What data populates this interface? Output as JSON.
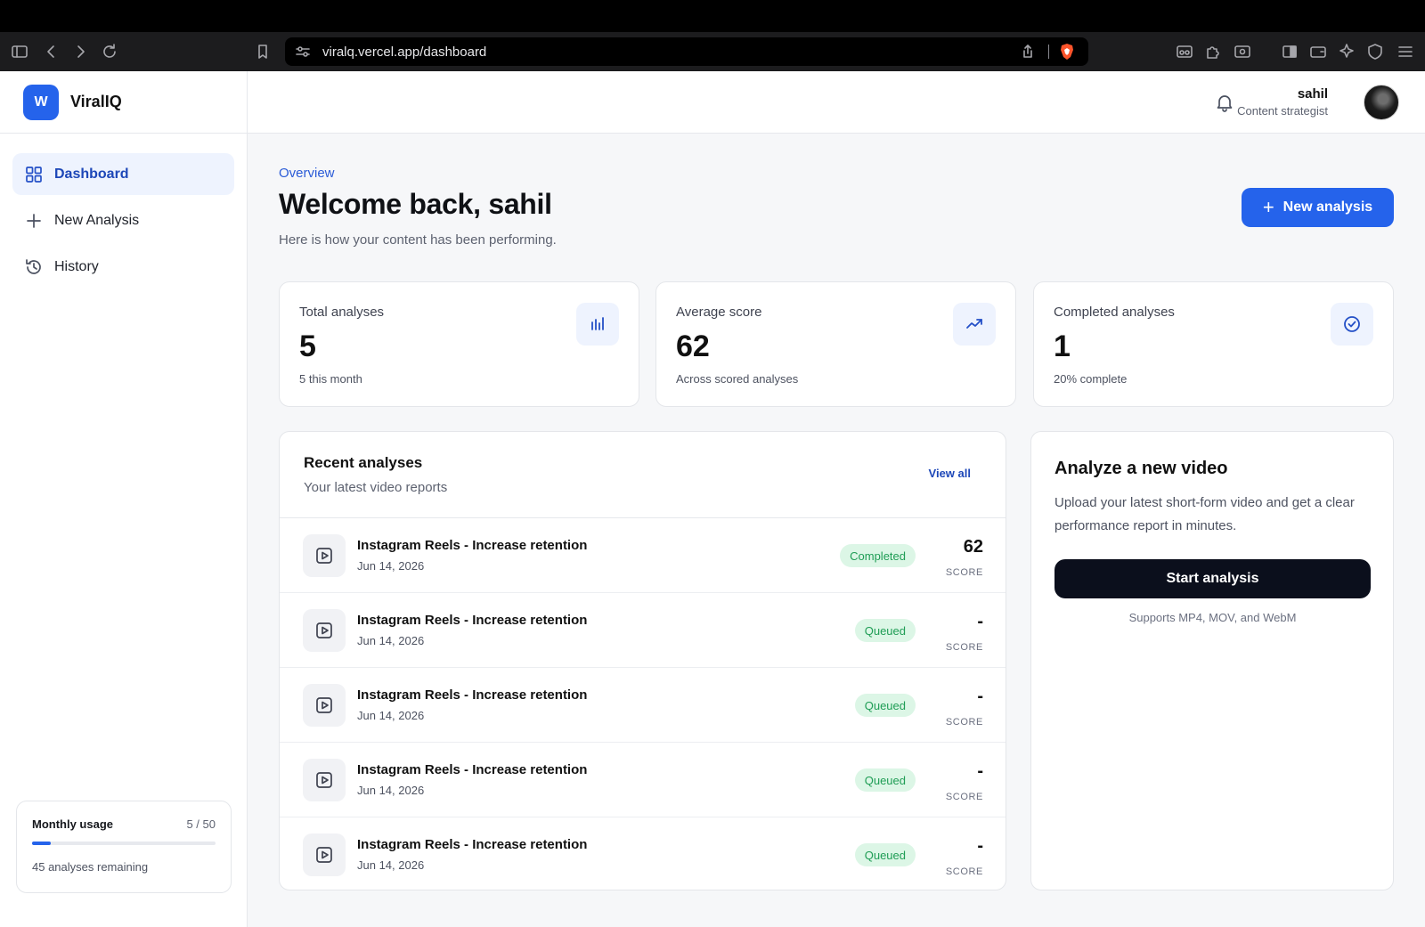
{
  "browser": {
    "url": "viralq.vercel.app/dashboard"
  },
  "sidebar": {
    "logo_letter": "W",
    "brand": "ViralIQ",
    "items": [
      {
        "label": "Dashboard",
        "icon": "grid-icon",
        "active": true
      },
      {
        "label": "New Analysis",
        "icon": "plus-icon",
        "active": false
      },
      {
        "label": "History",
        "icon": "history-icon",
        "active": false
      }
    ],
    "usage": {
      "title": "Monthly usage",
      "count": "5 / 50",
      "fraction": 0.1,
      "remaining": "45 analyses remaining"
    }
  },
  "header": {
    "user_name": "sahil",
    "user_role": "Content strategist"
  },
  "main": {
    "overline": "Overview",
    "title": "Welcome back, sahil",
    "subtitle": "Here is how your content has been performing.",
    "new_button": "New analysis",
    "stats": [
      {
        "label": "Total analyses",
        "value": "5",
        "note": "5 this month",
        "icon": "bar-chart-icon"
      },
      {
        "label": "Average score",
        "value": "62",
        "note": "Across scored analyses",
        "icon": "trending-up-icon"
      },
      {
        "label": "Completed analyses",
        "value": "1",
        "note": "20% complete",
        "icon": "check-circle-icon"
      }
    ],
    "recent": {
      "title": "Recent analyses",
      "subtitle": "Your latest video reports",
      "view_all": "View all",
      "score_label": "SCORE",
      "rows": [
        {
          "title": "Instagram Reels - Increase retention",
          "date": "Jun 14, 2026",
          "status": "Completed",
          "score": "62"
        },
        {
          "title": "Instagram Reels - Increase retention",
          "date": "Jun 14, 2026",
          "status": "Queued",
          "score": "-"
        },
        {
          "title": "Instagram Reels - Increase retention",
          "date": "Jun 14, 2026",
          "status": "Queued",
          "score": "-"
        },
        {
          "title": "Instagram Reels - Increase retention",
          "date": "Jun 14, 2026",
          "status": "Queued",
          "score": "-"
        },
        {
          "title": "Instagram Reels - Increase retention",
          "date": "Jun 14, 2026",
          "status": "Queued",
          "score": "-"
        }
      ]
    },
    "analyze": {
      "title": "Analyze a new video",
      "description": "Upload your latest short-form video and get a clear performance report in minutes.",
      "button": "Start analysis",
      "support": "Supports MP4, MOV, and WebM"
    }
  },
  "colors": {
    "accent": "#2563eb",
    "success_bg": "#dcf6e6",
    "success_text": "#1f9d55",
    "dark_button": "#0b0f1c"
  }
}
